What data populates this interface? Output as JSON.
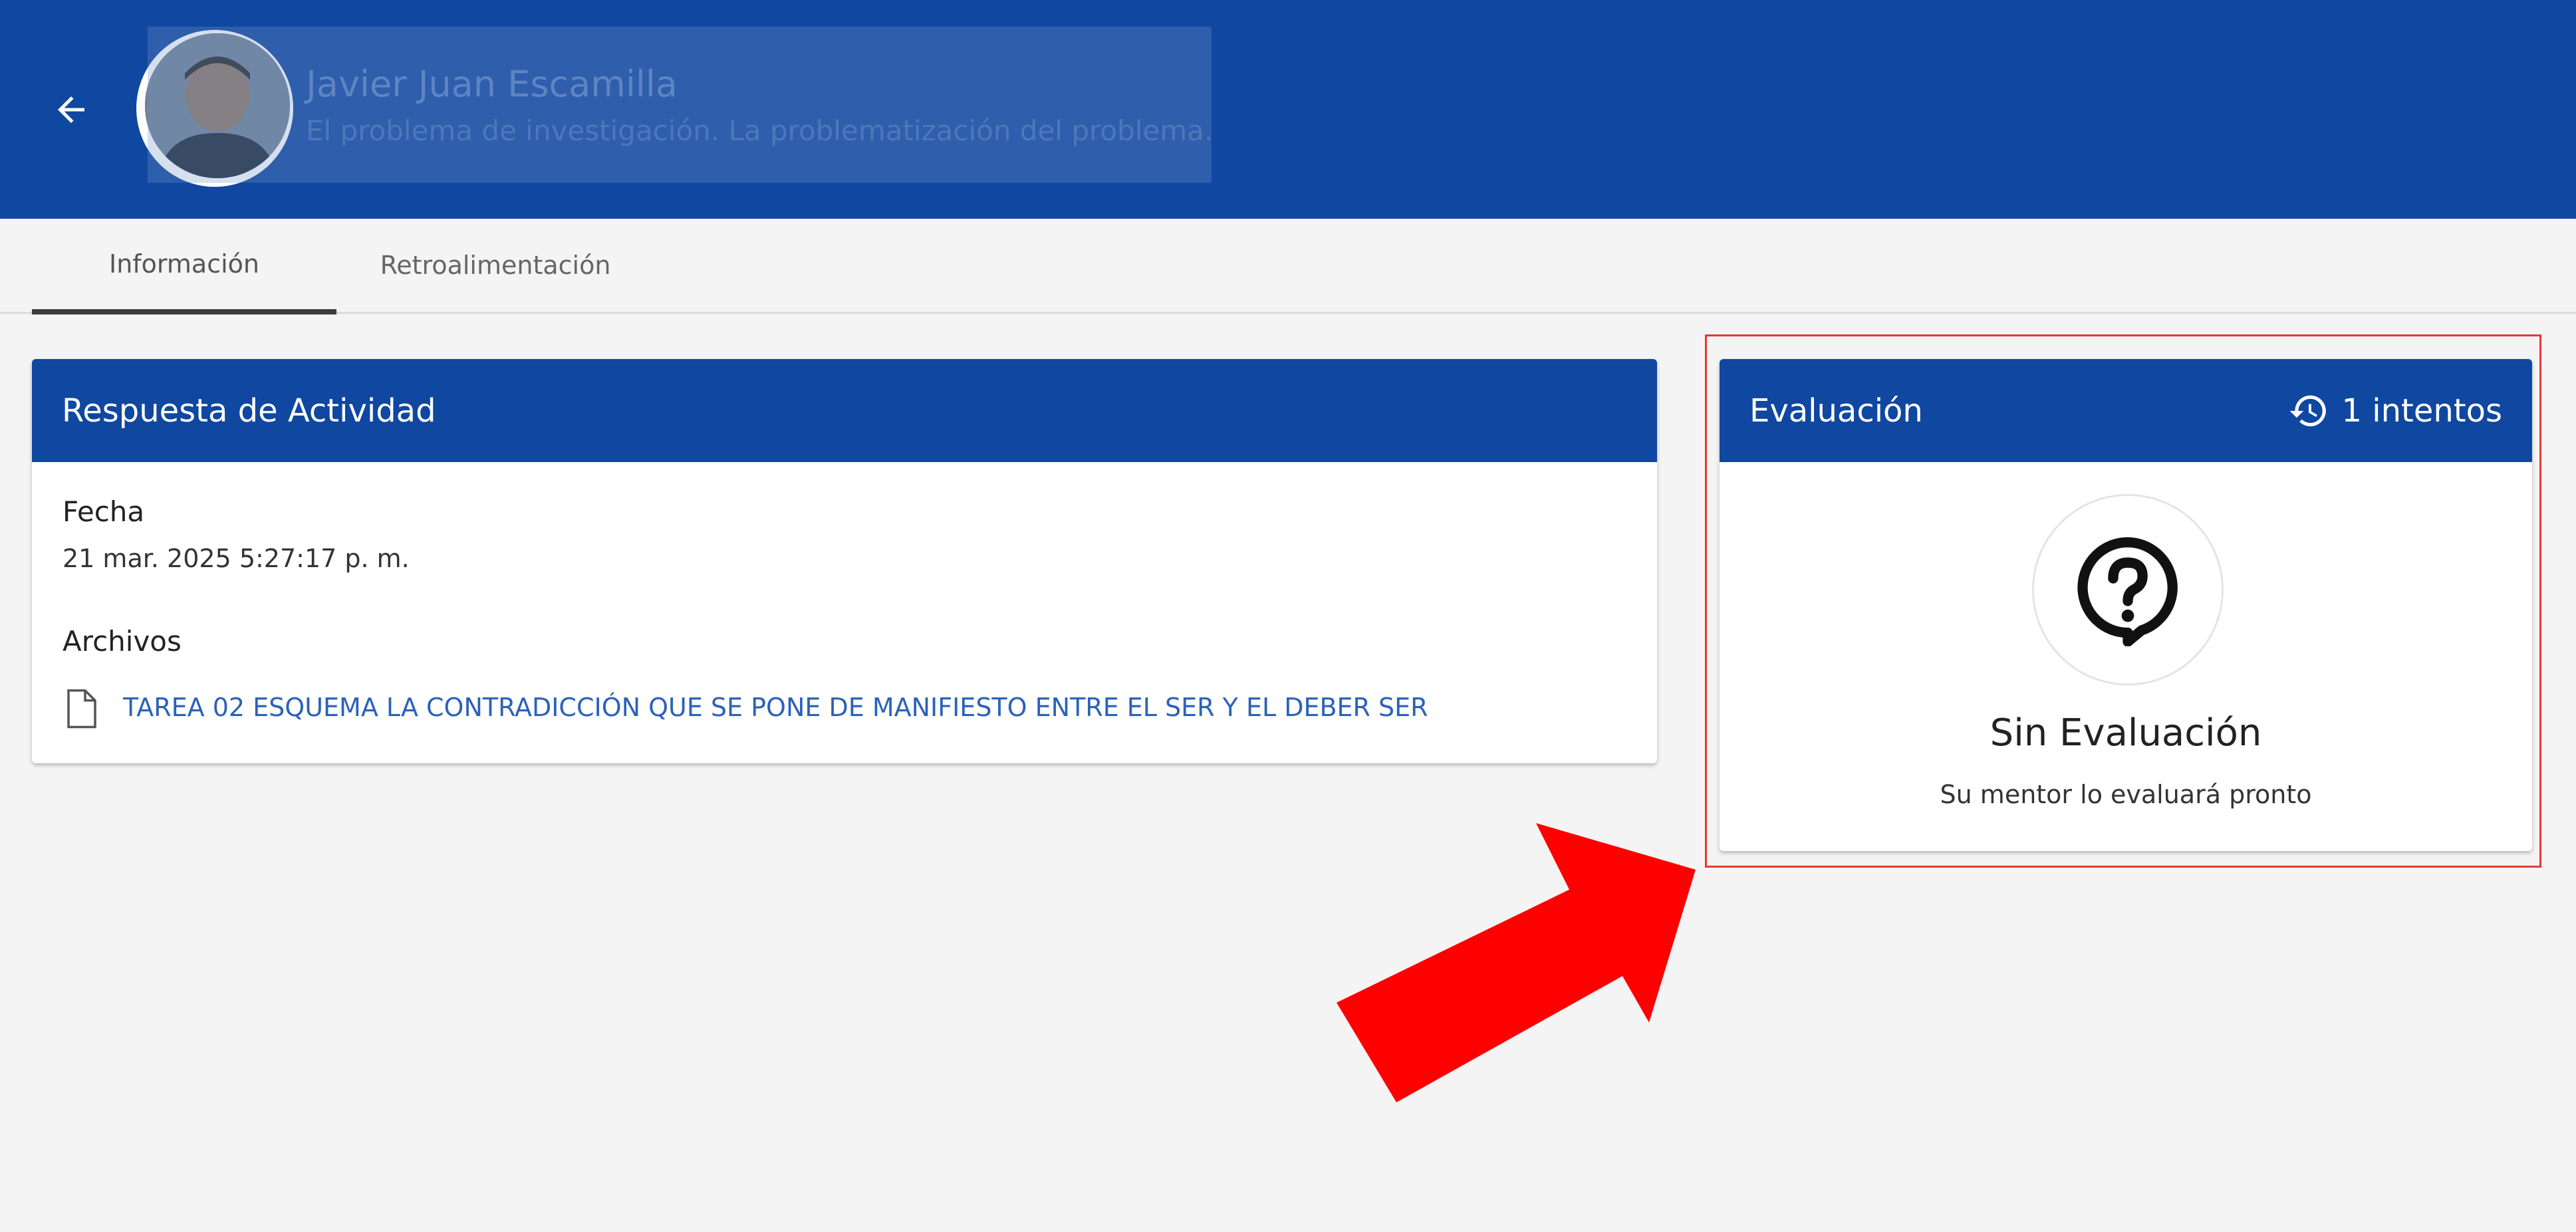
{
  "header": {
    "user_name": "Javier Juan Escamilla",
    "activity_title": "El problema de investigación. La problematización del problema.",
    "brand_color": "#0f47a1"
  },
  "tabs": [
    {
      "label": "Información",
      "active": true
    },
    {
      "label": "Retroalimentación",
      "active": false
    }
  ],
  "response_card": {
    "title": "Respuesta de Actividad",
    "date_label": "Fecha",
    "date_value": "21 mar. 2025 5:27:17 p. m.",
    "files_label": "Archivos",
    "files": [
      {
        "name": "TAREA 02 ESQUEMA LA CONTRADICCIÓN QUE SE PONE DE MANIFIESTO ENTRE EL SER Y EL DEBER SER",
        "icon": "file-icon"
      }
    ]
  },
  "evaluation_card": {
    "title": "Evaluación",
    "attempts": "1 intentos",
    "attempts_icon": "history-icon",
    "status_icon": "question-bubble-icon",
    "status": "Sin Evaluación",
    "note": "Su mentor lo evaluará pronto"
  },
  "annotation": {
    "highlight_color": "#e53935",
    "arrow_color": "#ff0000"
  }
}
